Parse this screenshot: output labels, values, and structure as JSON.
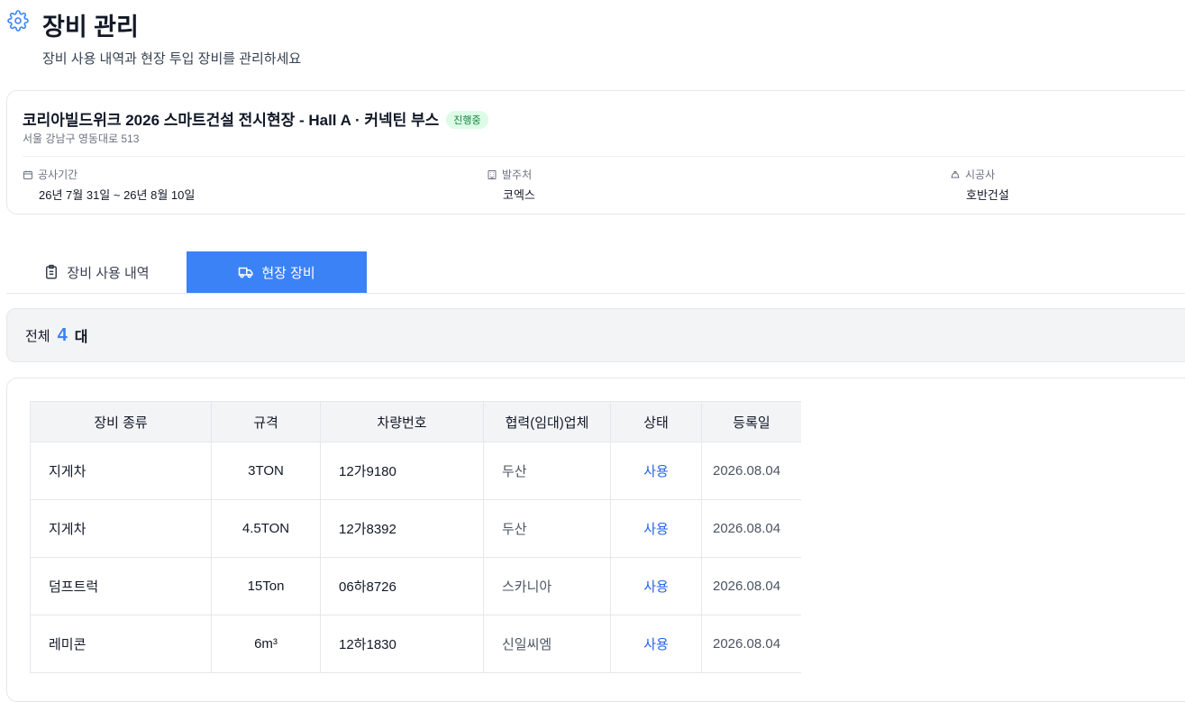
{
  "header": {
    "icon": "gear-icon",
    "title": "장비 관리",
    "subtitle": "장비 사용 내역과 현장 투입 장비를 관리하세요"
  },
  "project": {
    "name": "코리아빌드위크 2026 스마트건설 전시현장 - Hall A · 커넥틴 부스",
    "status": "진행중",
    "address": "서울 강남구 영동대로 513",
    "period_label": "공사기간",
    "period_value": "26년 7월 31일 ~ 26년 8월 10일",
    "client_label": "발주처",
    "client_value": "코엑스",
    "contractor_label": "시공사",
    "contractor_value": "호반건설"
  },
  "tabs": [
    {
      "label": "장비 사용 내역",
      "icon": "clipboard-icon",
      "active": false
    },
    {
      "label": "현장 장비",
      "icon": "truck-icon",
      "active": true
    }
  ],
  "summary": {
    "label": "전체",
    "count": "4",
    "unit": "대"
  },
  "table": {
    "headers": [
      "장비 종류",
      "규격",
      "차량번호",
      "협력(임대)업체",
      "상태",
      "등록일"
    ],
    "rows": [
      [
        "지게차",
        "3TON",
        "12가9180",
        "두산",
        "사용",
        "2026.08.04"
      ],
      [
        "지게차",
        "4.5TON",
        "12가8392",
        "두산",
        "사용",
        "2026.08.04"
      ],
      [
        "덤프트럭",
        "15Ton",
        "06하8726",
        "스카니아",
        "사용",
        "2026.08.04"
      ],
      [
        "레미콘",
        "6m³",
        "12하1830",
        "신일씨엠",
        "사용",
        "2026.08.04"
      ]
    ]
  },
  "colors": {
    "accent": "#3b82f6",
    "status_text": "#2563eb",
    "badge_bg": "#dcfce7",
    "badge_text": "#15803d"
  }
}
